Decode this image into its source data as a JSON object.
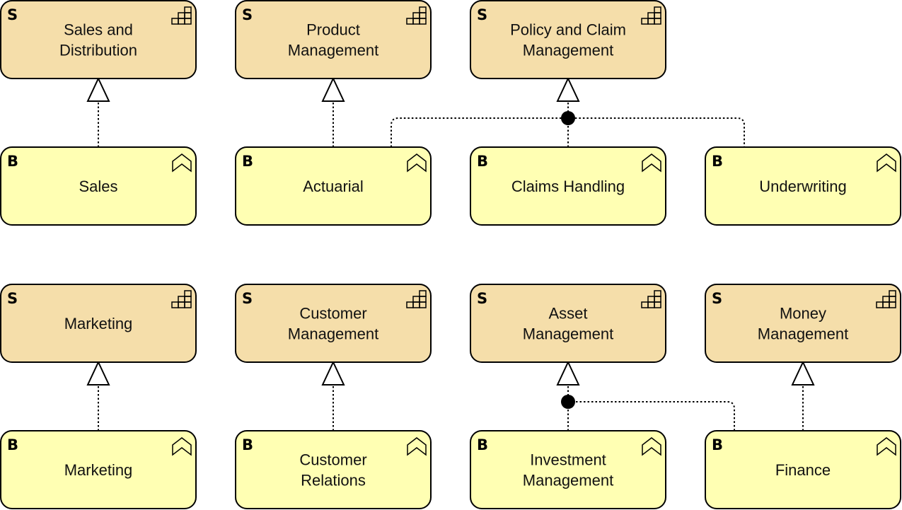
{
  "colors": {
    "capability_fill": "#f5deaa",
    "function_fill": "#ffffb3",
    "stroke": "#000000"
  },
  "elements": [
    {
      "type": "S",
      "icon": "capability-icon",
      "lines": [
        "Sales and",
        "Distribution"
      ]
    },
    {
      "type": "S",
      "icon": "capability-icon",
      "lines": [
        "Product",
        "Management"
      ]
    },
    {
      "type": "S",
      "icon": "capability-icon",
      "lines": [
        "Policy and Claim",
        "Management"
      ]
    },
    {
      "type": "B",
      "icon": "business-function-icon",
      "lines": [
        "Sales"
      ]
    },
    {
      "type": "B",
      "icon": "business-function-icon",
      "lines": [
        "Actuarial"
      ]
    },
    {
      "type": "B",
      "icon": "business-function-icon",
      "lines": [
        "Claims Handling"
      ]
    },
    {
      "type": "B",
      "icon": "business-function-icon",
      "lines": [
        "Underwriting"
      ]
    },
    {
      "type": "S",
      "icon": "capability-icon",
      "lines": [
        "Marketing"
      ]
    },
    {
      "type": "S",
      "icon": "capability-icon",
      "lines": [
        "Customer",
        "Management"
      ]
    },
    {
      "type": "S",
      "icon": "capability-icon",
      "lines": [
        "Asset",
        "Management"
      ]
    },
    {
      "type": "S",
      "icon": "capability-icon",
      "lines": [
        "Money",
        "Management"
      ]
    },
    {
      "type": "B",
      "icon": "business-function-icon",
      "lines": [
        "Marketing"
      ]
    },
    {
      "type": "B",
      "icon": "business-function-icon",
      "lines": [
        "Customer",
        "Relations"
      ]
    },
    {
      "type": "B",
      "icon": "business-function-icon",
      "lines": [
        "Investment",
        "Management"
      ]
    },
    {
      "type": "B",
      "icon": "business-function-icon",
      "lines": [
        "Finance"
      ]
    }
  ],
  "relationships": [
    {
      "kind": "realization",
      "from": [
        "Sales"
      ],
      "to": "Sales and Distribution"
    },
    {
      "kind": "realization",
      "from": [
        "Actuarial"
      ],
      "to": "Product Management"
    },
    {
      "kind": "realization-via-junction",
      "from": [
        "Actuarial",
        "Claims Handling",
        "Underwriting"
      ],
      "to": "Policy and Claim Management"
    },
    {
      "kind": "realization",
      "from": [
        "Marketing"
      ],
      "to": "Marketing"
    },
    {
      "kind": "realization",
      "from": [
        "Customer Relations"
      ],
      "to": "Customer Management"
    },
    {
      "kind": "realization-via-junction",
      "from": [
        "Investment Management",
        "Finance"
      ],
      "to": "Asset Management"
    },
    {
      "kind": "realization",
      "from": [
        "Finance"
      ],
      "to": "Money Management"
    }
  ]
}
